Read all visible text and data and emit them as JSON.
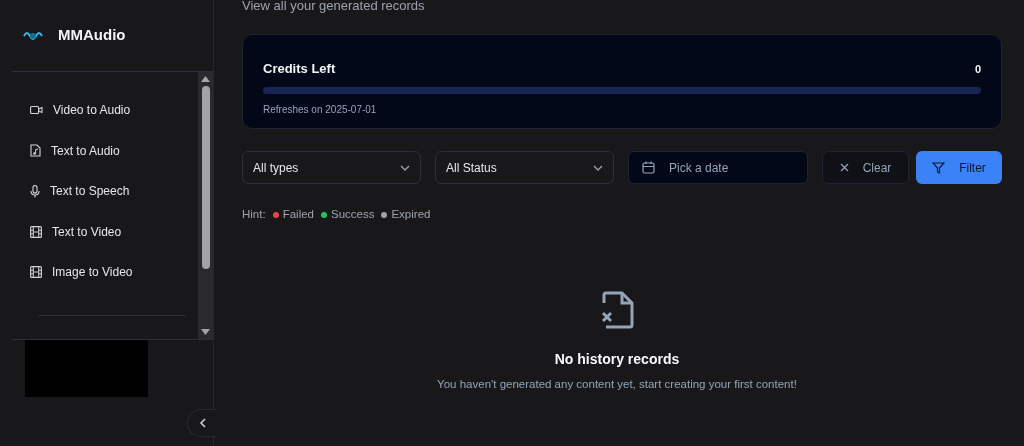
{
  "sidebar": {
    "brand": "MMAudio",
    "items": [
      {
        "label": "Video to Audio",
        "kind": "video"
      },
      {
        "label": "Text to Audio",
        "kind": "audio"
      },
      {
        "label": "Text to Speech",
        "kind": "speech"
      },
      {
        "label": "Text to Video",
        "kind": "film"
      },
      {
        "label": "Image to Video",
        "kind": "film"
      }
    ]
  },
  "subtitle": "View all your generated records",
  "credits": {
    "title": "Credits Left",
    "value": "0",
    "level": 0,
    "refresh": "Refreshes on 2025-07-01"
  },
  "filters": {
    "type_select": "All types",
    "status_select": "All Status",
    "date_placeholder": "Pick a date",
    "clear_button": "Clear",
    "filter_button": "Filter"
  },
  "hint": {
    "label": "Hint:",
    "legend": [
      {
        "label": "Failed",
        "color": "#ef4444"
      },
      {
        "label": "Success",
        "color": "#22c55e"
      },
      {
        "label": "Expired",
        "color": "#9ca3af"
      }
    ]
  },
  "empty_state": {
    "title": "No history records",
    "message": "You haven't generated any content yet, start creating your first content!"
  }
}
